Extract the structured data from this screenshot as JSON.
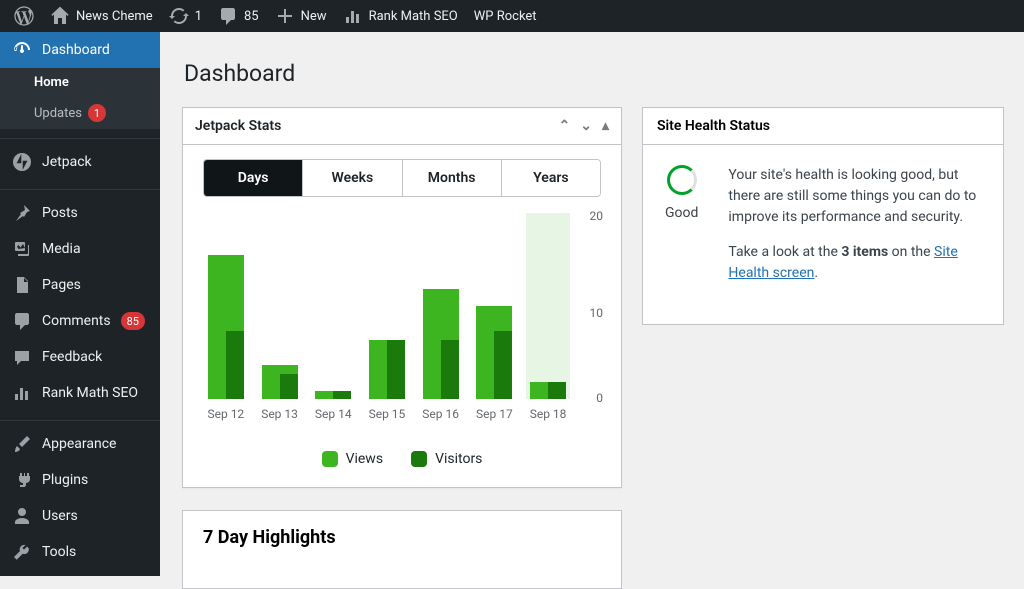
{
  "adminbar": {
    "site_name": "News Cheme",
    "updates": "1",
    "comments": "85",
    "new": "New",
    "rankmath": "Rank Math SEO",
    "wprocket": "WP Rocket"
  },
  "sidebar": {
    "dashboard": "Dashboard",
    "sub_home": "Home",
    "sub_updates": "Updates",
    "updates_count": "1",
    "jetpack": "Jetpack",
    "posts": "Posts",
    "media": "Media",
    "pages": "Pages",
    "comments": "Comments",
    "comments_count": "85",
    "feedback": "Feedback",
    "rankmath": "Rank Math SEO",
    "appearance": "Appearance",
    "plugins": "Plugins",
    "users": "Users",
    "tools": "Tools"
  },
  "page_title": "Dashboard",
  "jetpack": {
    "box_title": "Jetpack Stats",
    "tabs": {
      "days": "Days",
      "weeks": "Weeks",
      "months": "Months",
      "years": "Years"
    },
    "y20": "20",
    "y10": "10",
    "y0": "0",
    "legend_views": "Views",
    "legend_visitors": "Visitors"
  },
  "health": {
    "title": "Site Health Status",
    "status": "Good",
    "line1": "Your site's health is looking good, but there are still some things you can do to improve its performance and security.",
    "line2a": "Take a look at the ",
    "line2b": "3 items",
    "line2c": " on the ",
    "link": "Site Health screen",
    "dot": "."
  },
  "highlights_title": "7 Day Highlights",
  "chart_data": {
    "type": "bar",
    "title": "Jetpack Stats",
    "xlabel": "",
    "ylabel": "",
    "ylim": [
      0,
      22
    ],
    "categories": [
      "Sep 12",
      "Sep 13",
      "Sep 14",
      "Sep 15",
      "Sep 16",
      "Sep 17",
      "Sep 18"
    ],
    "series": [
      {
        "name": "Views",
        "values": [
          17,
          4,
          1,
          7,
          13,
          11,
          2
        ],
        "color": "#3cb521"
      },
      {
        "name": "Visitors",
        "values": [
          8,
          3,
          1,
          7,
          7,
          8,
          2
        ],
        "color": "#1a7a0b"
      }
    ],
    "highlight_index": 6
  }
}
